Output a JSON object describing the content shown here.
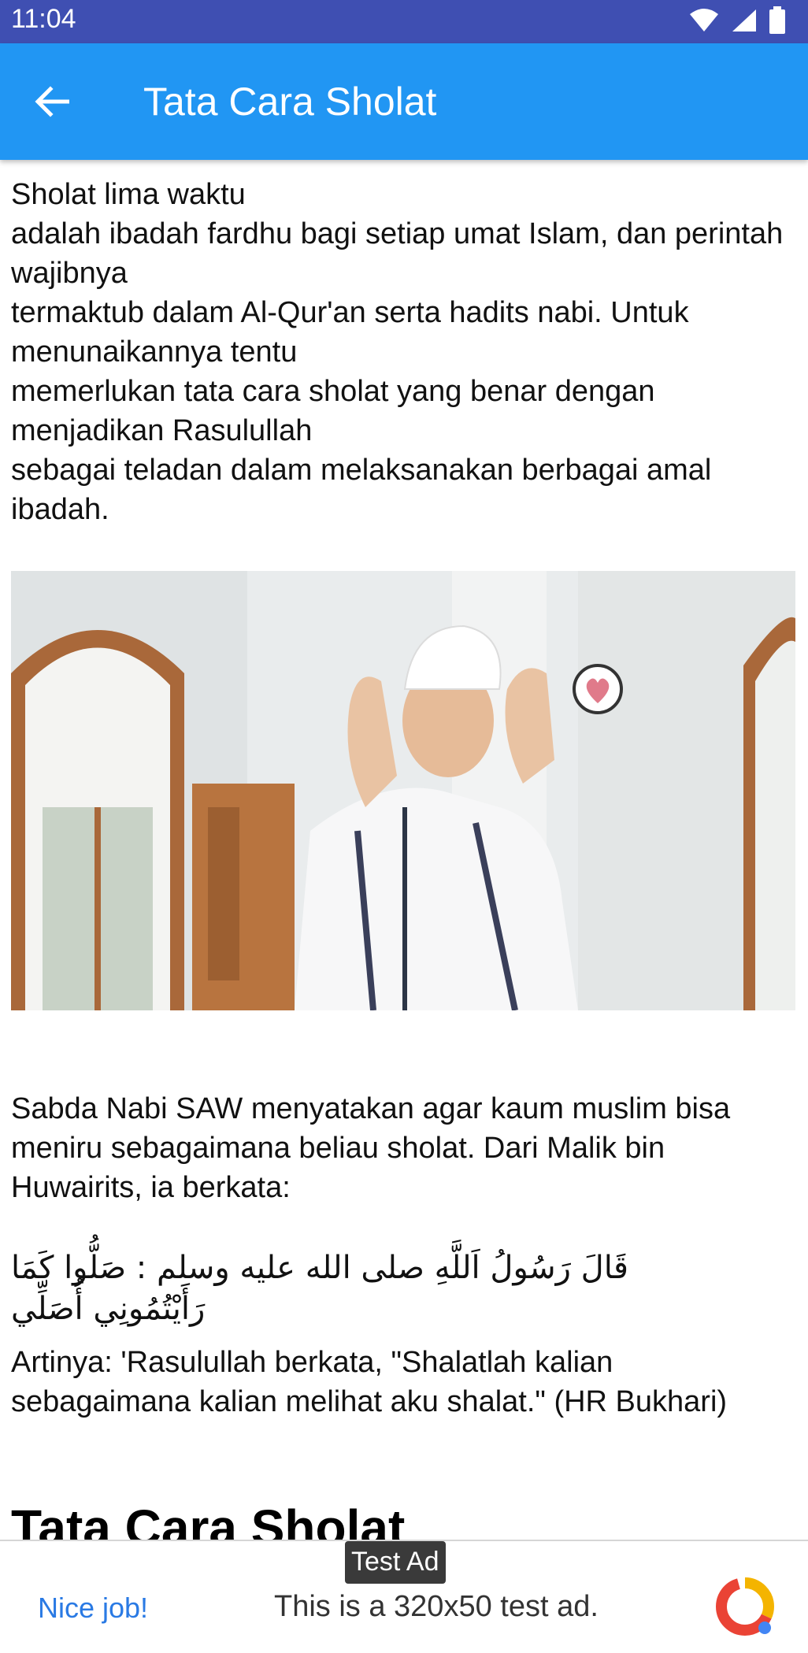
{
  "status_bar": {
    "time": "11:04",
    "icons": [
      "wifi-icon",
      "signal-icon",
      "battery-icon"
    ]
  },
  "app_bar": {
    "back_icon": "arrow-left-icon",
    "title": "Tata Cara Sholat",
    "color": "#2196f3"
  },
  "article": {
    "intro": "Sholat lima waktu\nadalah ibadah fardhu bagi setiap umat Islam, dan perintah wajibnya\ntermaktub dalam Al-Qur'an serta hadits nabi. Untuk menunaikannya tentu\nmemerlukan tata cara sholat yang benar dengan menjadikan Rasulullah\nsebagai teladan dalam melaksanakan berbagai amal ibadah.",
    "hadith_intro": "Sabda Nabi SAW menyatakan agar kaum muslim bisa meniru sebagaimana beliau sholat. Dari Malik bin Huwairits, ia berkata:",
    "arabic": "قَالَ رَسُولُ اَللَّهِ صلى الله عليه وسلم : صَلُّوا كَمَا رَأَيْتُمُونِي أُصَلِّي",
    "translation": "Artinya: 'Rasulullah berkata, \"Shalatlah kalian sebagaimana kalian melihat aku shalat.\" (HR Bukhari)",
    "section_title": "Tata Cara Sholat"
  },
  "ad": {
    "label": "Test Ad",
    "nice": "Nice job!",
    "text": "This is a 320x50 test ad."
  }
}
